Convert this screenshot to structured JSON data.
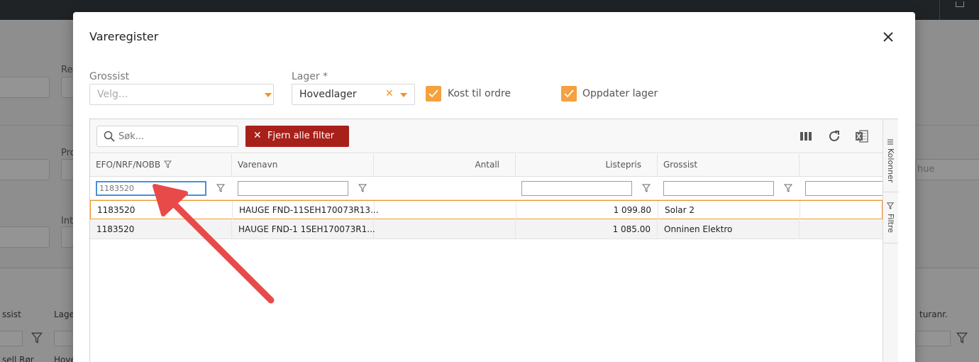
{
  "background": {
    "labels": [
      "Re",
      "Pro",
      "Int"
    ],
    "grid_headers": [
      "ssist",
      "Lage",
      "turanr."
    ],
    "grid_cells": [
      "sell Rør",
      "Hove"
    ],
    "placeholder_fragment": "hue"
  },
  "modal": {
    "title": "Vareregister",
    "grossist": {
      "label": "Grossist",
      "placeholder": "Velg..."
    },
    "lager": {
      "label": "Lager *",
      "value": "Hovedlager"
    },
    "checkboxes": [
      {
        "label": "Kost til ordre",
        "checked": true
      },
      {
        "label": "Oppdater lager",
        "checked": true
      }
    ]
  },
  "grid": {
    "search_placeholder": "Søk...",
    "clear_filters_label": "Fjern alle  filter",
    "side_tabs": {
      "columns": "Kolonner",
      "filters": "Filtre"
    },
    "columns": [
      {
        "label": "EFO/NRF/NOBB",
        "filter_value": "1183520"
      },
      {
        "label": "Varenavn",
        "filter_value": ""
      },
      {
        "label": "Antall"
      },
      {
        "label": "Listepris",
        "filter_value": ""
      },
      {
        "label": "Grossist",
        "filter_value": ""
      },
      {
        "label": ""
      }
    ],
    "rows": [
      {
        "efo": "1183520",
        "varenavn": "HAUGE FND-11SEH170073R13...",
        "antall": "",
        "listepris": "1 099.80",
        "grossist": "Solar 2"
      },
      {
        "efo": "1183520",
        "varenavn": "HAUGE FND-1 1SEH170073R1...",
        "antall": "",
        "listepris": "1 085.00",
        "grossist": "Onninen Elektro"
      }
    ]
  },
  "colors": {
    "accent": "#f39322",
    "danger": "#a8201a",
    "annotation_arrow": "#e84a4a"
  },
  "icons": [
    "close-icon",
    "chevron-down-icon",
    "check-icon",
    "search-icon",
    "columns-icon",
    "refresh-icon",
    "excel-icon",
    "filter-icon",
    "menu-icon",
    "arrow-annotation"
  ]
}
